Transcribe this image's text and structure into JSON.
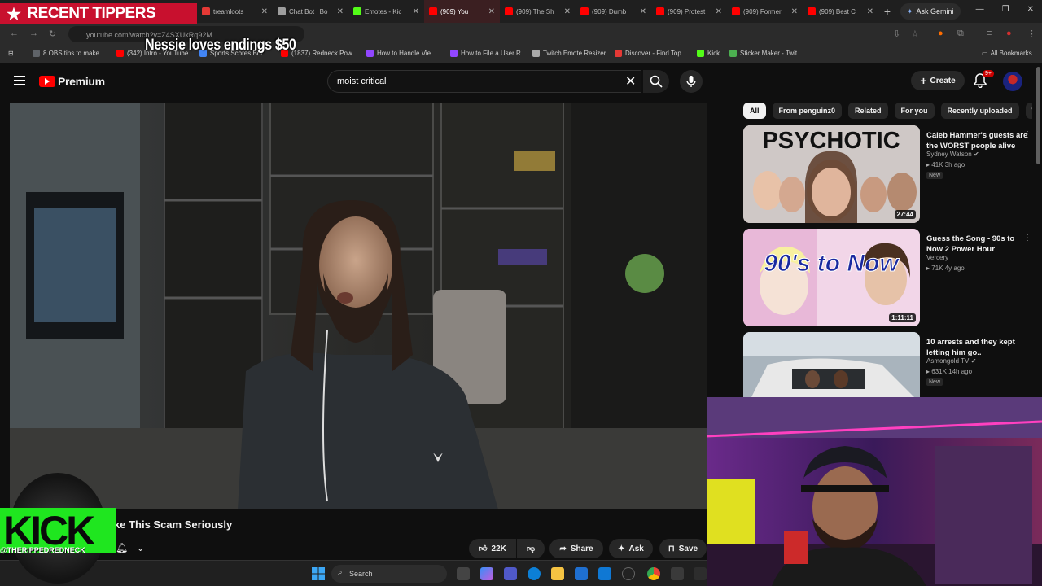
{
  "browser": {
    "tabs": [
      {
        "title": "treamloots",
        "icon": "red",
        "active": false
      },
      {
        "title": "Chat Bot | Bo",
        "icon": "shield",
        "active": false
      },
      {
        "title": "Emotes - Kic",
        "icon": "kick",
        "active": false
      },
      {
        "title": "(909) You",
        "icon": "youtube",
        "active": true
      },
      {
        "title": "(909) The Sh",
        "icon": "youtube",
        "active": false
      },
      {
        "title": "(909) Dumb",
        "icon": "youtube",
        "active": false
      },
      {
        "title": "(909) Protest",
        "icon": "youtube",
        "active": false
      },
      {
        "title": "(909) Former",
        "icon": "youtube",
        "active": false
      },
      {
        "title": "(909) Best C",
        "icon": "youtube",
        "active": false
      }
    ],
    "new_tab_label": "+",
    "gemini_label": "Ask Gemini",
    "url": "youtube.com/watch?v=Z4SXUkRq92M",
    "bookmarks": [
      {
        "label": "8 OBS tips to make...",
        "color": "#5f6368"
      },
      {
        "label": "(342) Intro - YouTube",
        "color": "#ff0000"
      },
      {
        "label": "Sports Scores Bot",
        "color": "#4285f4"
      },
      {
        "label": "(1837) Redneck Pow...",
        "color": "#ff0000"
      },
      {
        "label": "How to Handle Vie...",
        "color": "#9146ff"
      },
      {
        "label": "How to File a User R...",
        "color": "#9146ff"
      },
      {
        "label": "Twitch Emote Resizer",
        "color": "#aaaaaa"
      },
      {
        "label": "Discover - Find Top...",
        "color": "#e53935"
      },
      {
        "label": "Kick",
        "color": "#53fc18"
      },
      {
        "label": "Sticker Maker - Twit...",
        "color": "#4caf50"
      }
    ],
    "all_bookmarks_label": "All Bookmarks"
  },
  "overlay": {
    "tipper_banner": "RECENT TIPPERS",
    "tip_message": "Nessie loves endings $50",
    "kick_logo_text": "KICK",
    "kick_handle": "@THERIPPEDREDNECK"
  },
  "youtube": {
    "logo_text": "Premium",
    "search_value": "moist critical",
    "create_label": "Create",
    "notification_count": "9+",
    "chips": [
      "All",
      "From penguinz0",
      "Related",
      "For you",
      "Recently uploaded",
      "Wa"
    ],
    "recommendations": [
      {
        "title": "Caleb Hammer's guests are the WORST people alive",
        "channel": "Sydney Watson",
        "meta": "41K  3h ago",
        "badge": "New",
        "duration": "27:44",
        "thumb_text": "PSYCHOTIC"
      },
      {
        "title": "Guess the Song - 90s to Now 2 Power Hour",
        "channel": "Vercery",
        "meta": "71K  4y ago",
        "badge": "",
        "duration": "1:11:11",
        "thumb_text": "90's to Now"
      },
      {
        "title": "10 arrests and they kept letting him go..",
        "channel": "Asmongold TV",
        "meta": "631K  14h ago",
        "badge": "New",
        "duration": "",
        "thumb_text": ""
      }
    ],
    "video_title": "ke This Scam Seriously",
    "like_count": "22K",
    "share_label": "Share",
    "ask_label": "Ask",
    "save_label": "Save"
  },
  "taskbar": {
    "search_placeholder": "Search"
  },
  "colors": {
    "youtube_red": "#ff0000",
    "kick_green": "#1fe61f",
    "tipper_red": "#c8102e",
    "page_bg": "#0f0f0f"
  }
}
